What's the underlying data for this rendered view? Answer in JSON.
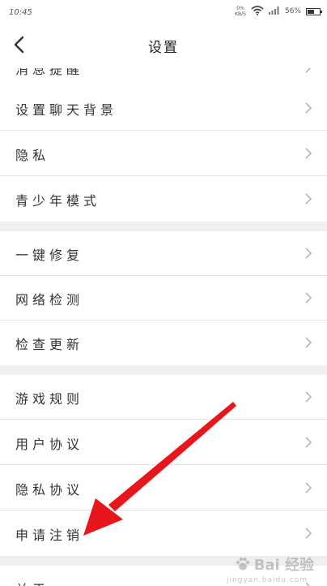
{
  "status_bar": {
    "time": "10:45",
    "net_speed_value": "0%",
    "net_speed_unit": "KB/S",
    "battery_percent": "56%",
    "battery_level": 0.56
  },
  "nav": {
    "title": "设置"
  },
  "settings": {
    "group1": [
      {
        "label": "消息提醒"
      },
      {
        "label": "设置聊天背景"
      },
      {
        "label": "隐私"
      },
      {
        "label": "青少年模式"
      }
    ],
    "group2": [
      {
        "label": "一键修复"
      },
      {
        "label": "网络检测"
      },
      {
        "label": "检查更新"
      }
    ],
    "group3": [
      {
        "label": "游戏规则"
      },
      {
        "label": "用户协议"
      },
      {
        "label": "隐私协议"
      },
      {
        "label": "申请注销"
      }
    ],
    "group4": [
      {
        "label": "关于"
      }
    ]
  },
  "watermark": {
    "brand": "Bai  经验",
    "sub": "jingyan.baidu.com"
  },
  "colors": {
    "annotation_arrow": "#e8161b",
    "section_gap": "#efefef",
    "divider": "#e6e6e6"
  }
}
